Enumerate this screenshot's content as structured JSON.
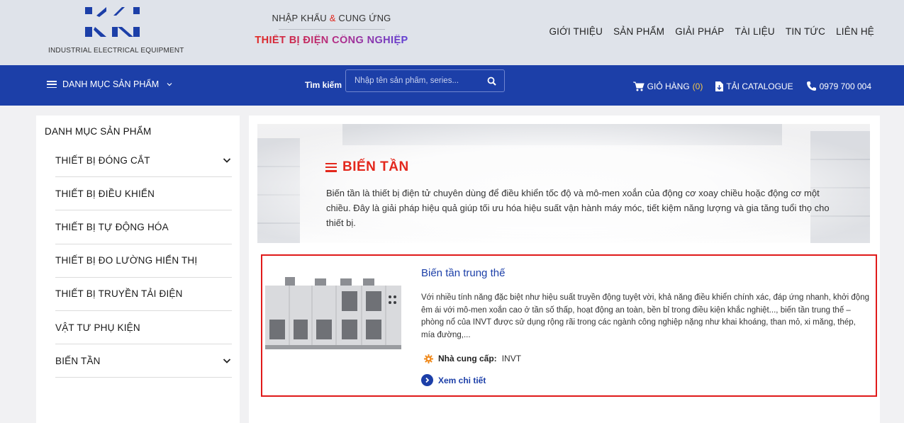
{
  "header": {
    "logo_caption": "INDUSTRIAL ELECTRICAL EQUIPMENT",
    "tagline_part1": "NHẬP KHẨU ",
    "tagline_amp": "&",
    "tagline_part2": " CUNG ỨNG",
    "tagline_main": "THIẾT BỊ ĐIỆN CÔNG NGHIỆP",
    "nav": [
      {
        "label": "GIỚI THIỆU"
      },
      {
        "label": "SẢN PHẨM"
      },
      {
        "label": "GIẢI PHÁP"
      },
      {
        "label": "TÀI LIỆU"
      },
      {
        "label": "TIN TỨC"
      },
      {
        "label": "LIÊN HỆ"
      }
    ]
  },
  "toolbar": {
    "category_menu_label": "DANH MỤC SẢN PHẨM",
    "search_label": "Tìm kiếm",
    "search_placeholder": "Nhập tên sản phẩm, series...",
    "cart_label": "GIỎ HÀNG",
    "cart_count": "(0)",
    "catalogue_label": "TẢI CATALOGUE",
    "phone": "0979 700 004"
  },
  "sidebar": {
    "title": "DANH MỤC SẢN PHẨM",
    "items": [
      {
        "label": "THIẾT BỊ ĐÓNG CẮT",
        "has_children": true
      },
      {
        "label": "THIẾT BỊ ĐIỀU KHIỂN",
        "has_children": false
      },
      {
        "label": "THIẾT BỊ TỰ ĐỘNG HÓA",
        "has_children": false
      },
      {
        "label": "THIẾT BỊ ĐO LƯỜNG HIỂN THỊ",
        "has_children": false
      },
      {
        "label": "THIẾT BỊ TRUYỀN TẢI ĐIỆN",
        "has_children": false
      },
      {
        "label": "VẬT TƯ PHỤ KIỆN",
        "has_children": false
      },
      {
        "label": "BIẾN TẦN",
        "has_children": true
      }
    ]
  },
  "main": {
    "title": "BIẾN TẦN",
    "description": "Biến tần là thiết bị điện tử chuyên dùng để điều khiển tốc độ và mô-men xoắn của động cơ xoay chiều hoặc động cơ một chiều. Đây là giải pháp hiệu quả giúp tối ưu hóa hiệu suất vận hành máy móc, tiết kiệm năng lượng và gia tăng tuổi thọ cho thiết bị.",
    "product": {
      "title": "Biến tần trung thế",
      "description": "Với nhiều tính năng đặc biệt như hiệu suất truyền động tuyệt vời, khả năng điều khiển chính xác, đáp ứng nhanh, khởi động êm ái với mô-men xoắn cao ở tần số thấp, hoạt động an toàn, bền bỉ trong điều kiện khắc nghiệt..., biến tần trung thế – phòng nổ của INVT được sử dụng rộng rãi trong các ngành công nghiệp nặng như khai khoáng, than mỏ, xi măng, thép, mía đường,...",
      "supplier_label": "Nhà cung cấp:",
      "supplier_value": "INVT",
      "detail_link": "Xem chi tiết"
    }
  },
  "colors": {
    "brand_blue": "#1c3fa8",
    "accent_red": "#e3271c",
    "highlight_border": "#e01a1a",
    "supplier_icon": "#f08a1c"
  },
  "icons": {
    "menu": "hamburger-icon",
    "dropdown": "chevron-down-icon",
    "search": "search-icon",
    "cart": "cart-icon",
    "catalogue": "file-download-icon",
    "phone": "phone-icon",
    "supplier": "gear-icon",
    "detail": "arrow-right-circle-icon"
  }
}
